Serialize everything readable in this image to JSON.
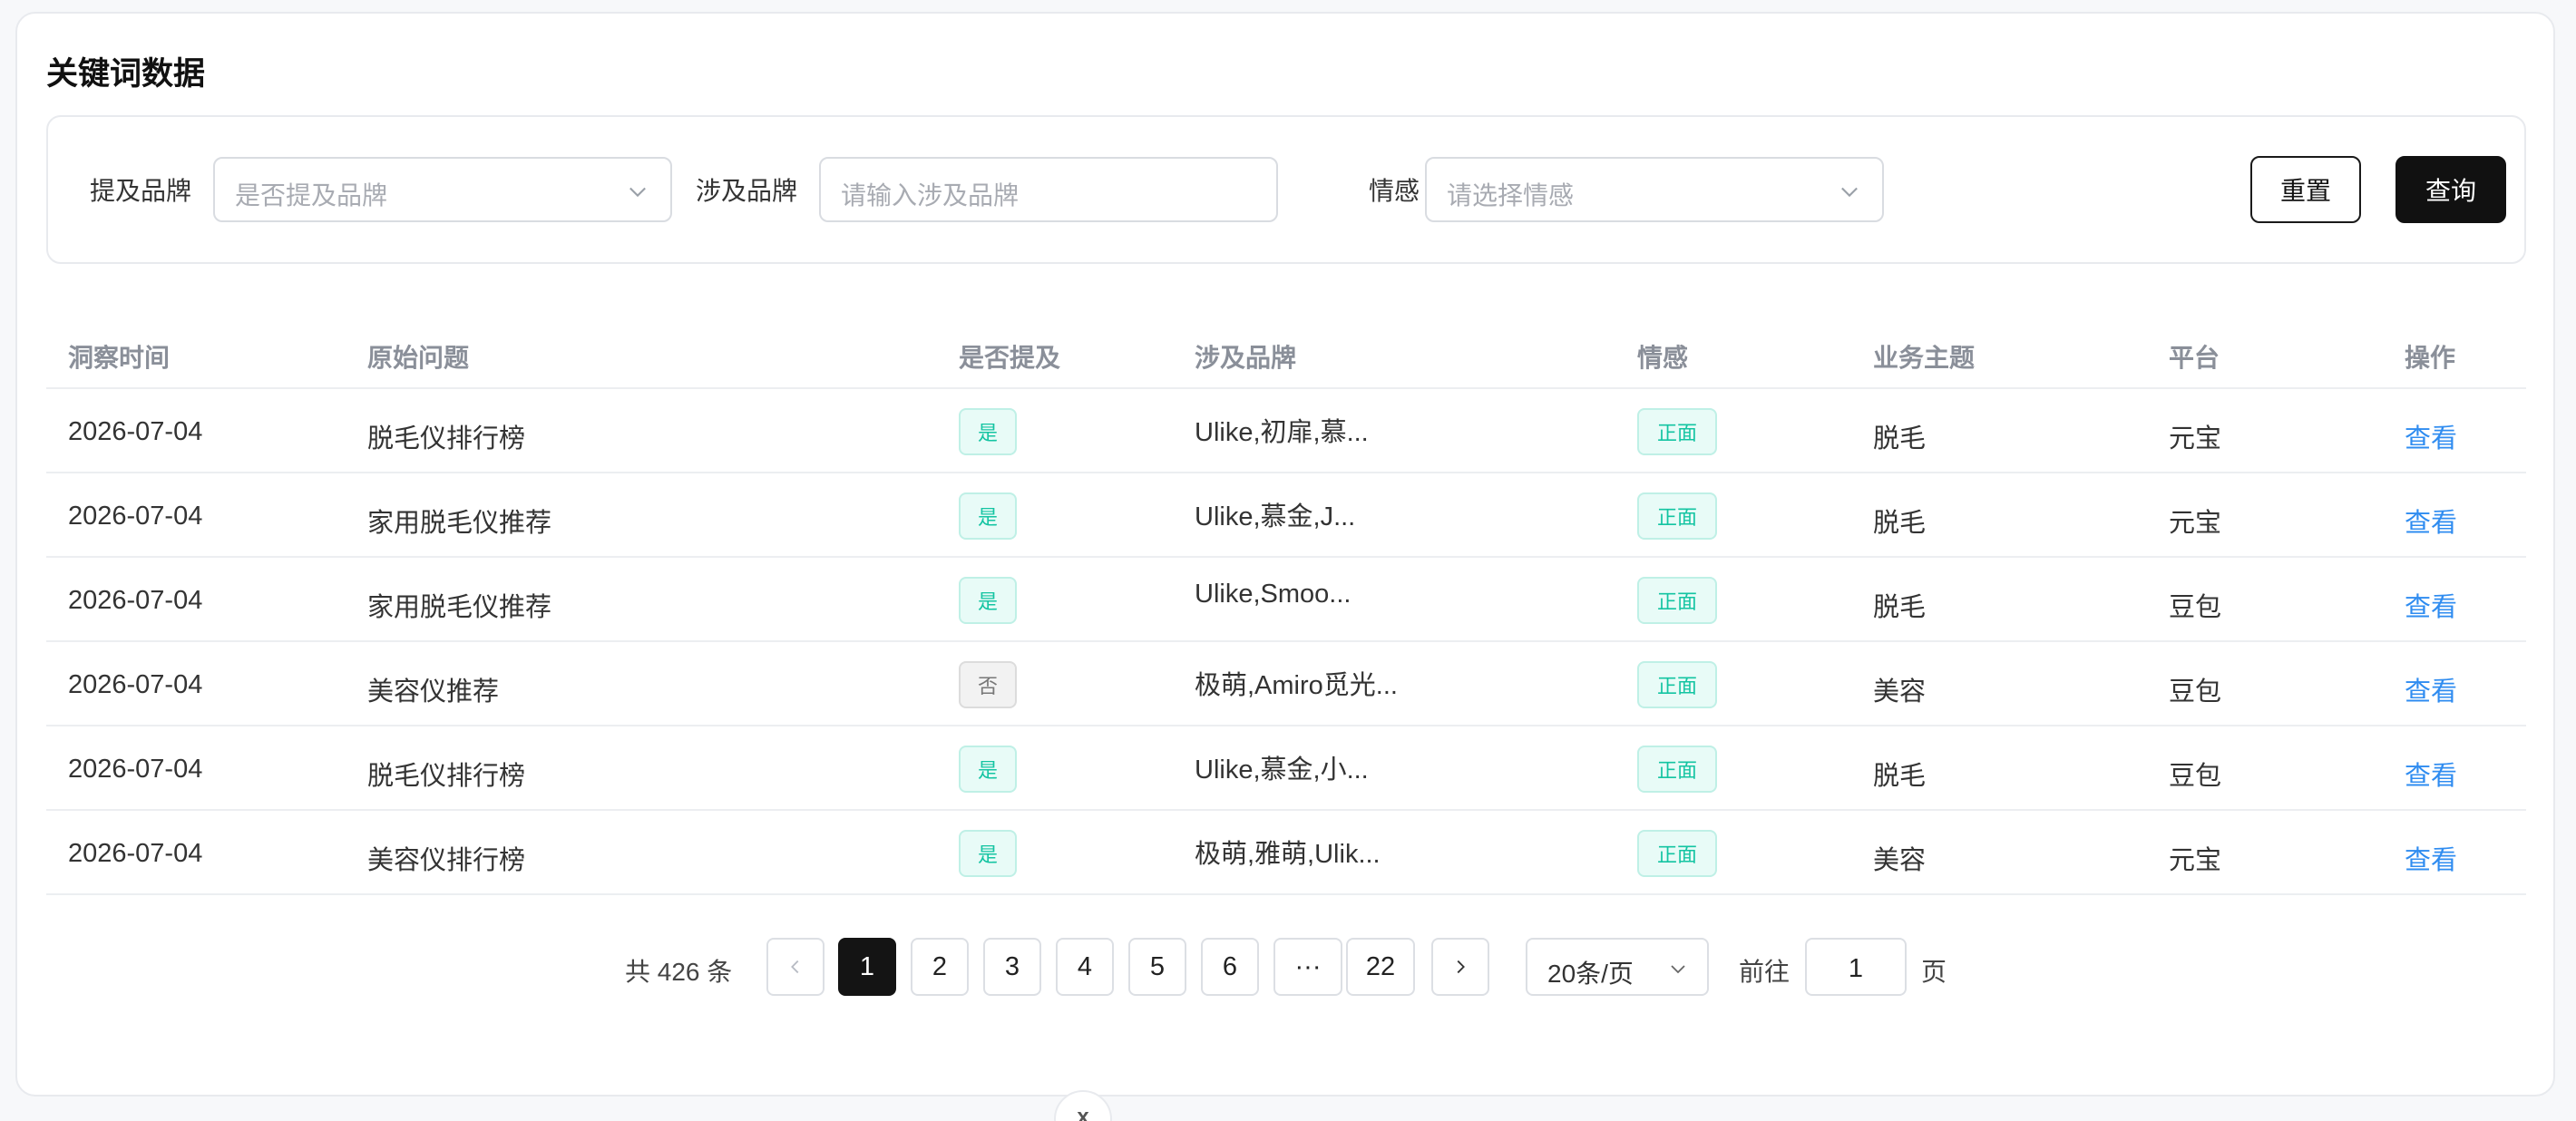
{
  "page": {
    "title": "关键词数据"
  },
  "filters": {
    "mention_label": "提及品牌",
    "mention_placeholder": "是否提及品牌",
    "brand_label": "涉及品牌",
    "brand_placeholder": "请输入涉及品牌",
    "sentiment_label": "情感",
    "sentiment_placeholder": "请选择情感",
    "reset_label": "重置",
    "query_label": "查询"
  },
  "table": {
    "columns": [
      "洞察时间",
      "原始问题",
      "是否提及",
      "涉及品牌",
      "情感",
      "业务主题",
      "平台",
      "操作"
    ],
    "rows": [
      {
        "date": "2026-07-04",
        "question": "脱毛仪排行榜",
        "mentioned": "是",
        "brands": "Ulike,初扉,慕...",
        "sentiment": "正面",
        "topic": "脱毛",
        "platform": "元宝",
        "action": "查看"
      },
      {
        "date": "2026-07-04",
        "question": "家用脱毛仪推荐",
        "mentioned": "是",
        "brands": "Ulike,慕金,J...",
        "sentiment": "正面",
        "topic": "脱毛",
        "platform": "元宝",
        "action": "查看"
      },
      {
        "date": "2026-07-04",
        "question": "家用脱毛仪推荐",
        "mentioned": "是",
        "brands": "Ulike,Smoo...",
        "sentiment": "正面",
        "topic": "脱毛",
        "platform": "豆包",
        "action": "查看"
      },
      {
        "date": "2026-07-04",
        "question": "美容仪推荐",
        "mentioned": "否",
        "brands": "极萌,Amiro觅光...",
        "sentiment": "正面",
        "topic": "美容",
        "platform": "豆包",
        "action": "查看"
      },
      {
        "date": "2026-07-04",
        "question": "脱毛仪排行榜",
        "mentioned": "是",
        "brands": "Ulike,慕金,小...",
        "sentiment": "正面",
        "topic": "脱毛",
        "platform": "豆包",
        "action": "查看"
      },
      {
        "date": "2026-07-04",
        "question": "美容仪排行榜",
        "mentioned": "是",
        "brands": "极萌,雅萌,Ulik...",
        "sentiment": "正面",
        "topic": "美容",
        "platform": "元宝",
        "action": "查看"
      }
    ]
  },
  "pagination": {
    "total_text": "共 426 条",
    "pages": [
      "1",
      "2",
      "3",
      "4",
      "5",
      "6",
      "···",
      "22"
    ],
    "current": "1",
    "page_size": "20条/页",
    "goto_label": "前往",
    "goto_value": "1",
    "page_suffix": "页"
  },
  "colors": {
    "accent": "#111111",
    "link": "#2f8cf0",
    "positive": "#14c4a2"
  },
  "icons": {
    "select_chevron": "chevron-down-icon",
    "prev": "chevron-left-icon",
    "next": "chevron-right-icon"
  }
}
